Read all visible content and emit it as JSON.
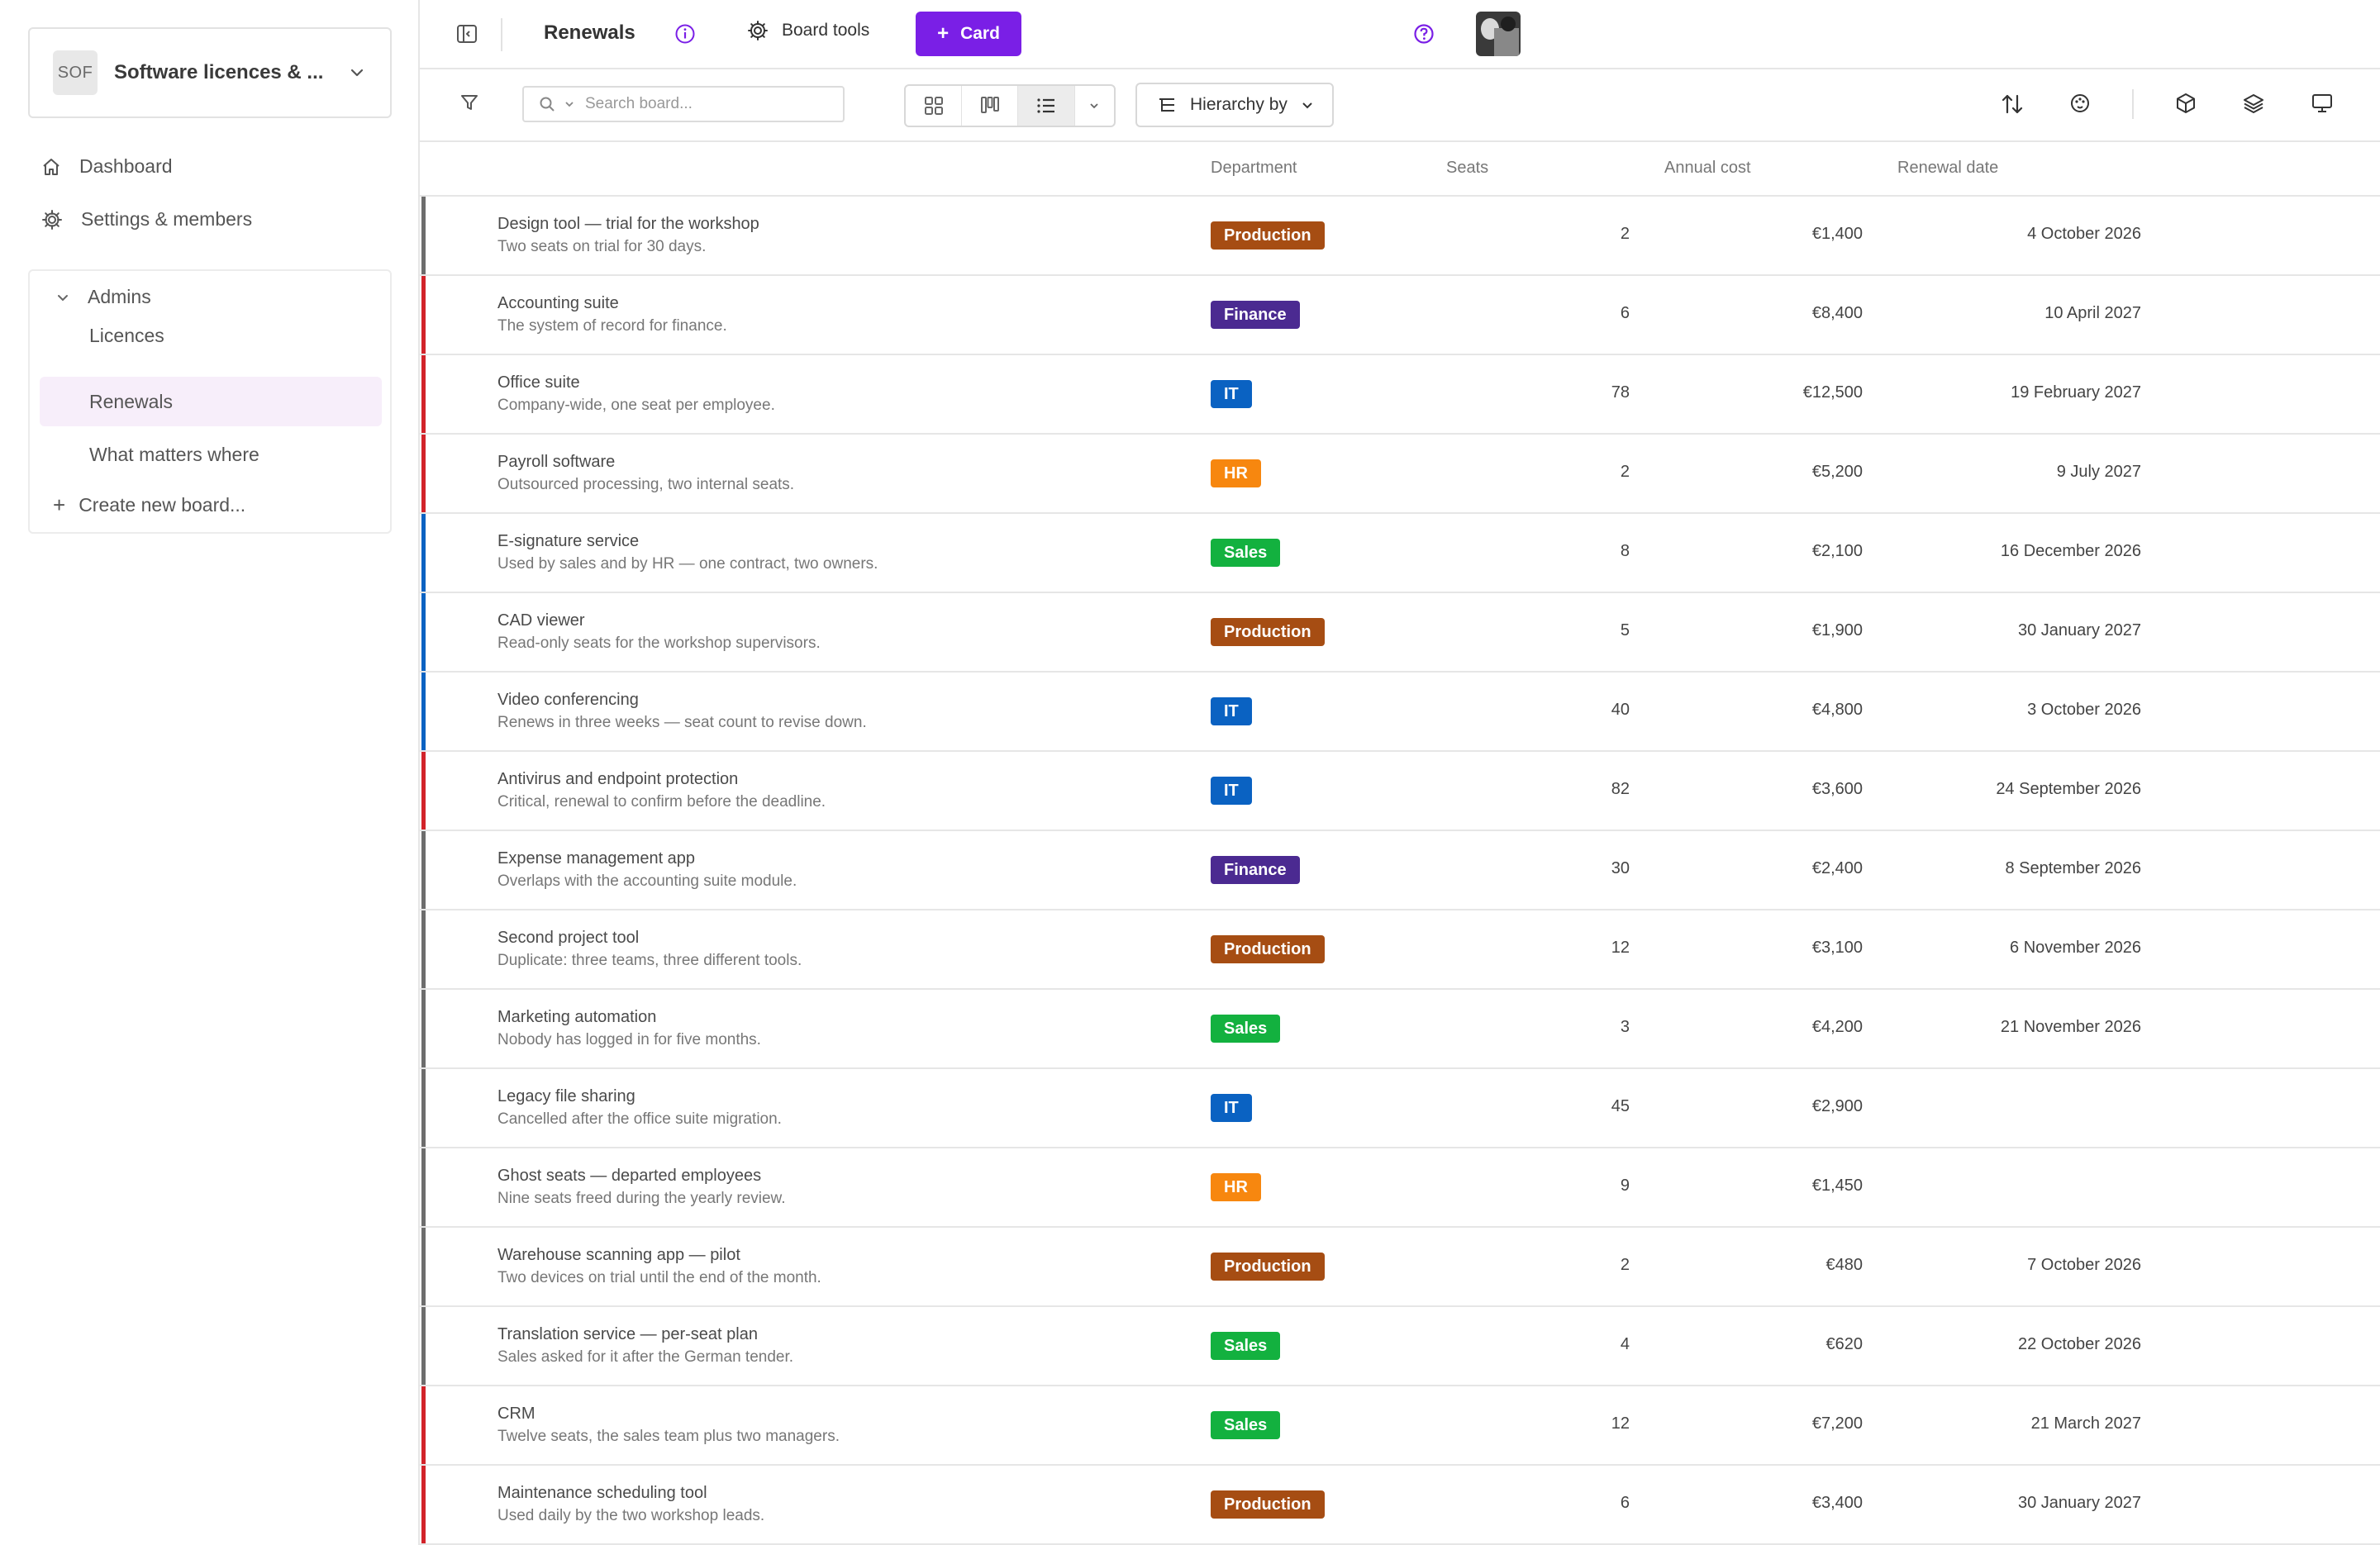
{
  "workspace": {
    "badge": "SOF",
    "name": "Software licences & ..."
  },
  "nav": {
    "dashboard": "Dashboard",
    "settings": "Settings & members"
  },
  "group": {
    "title": "Admins",
    "boards": [
      "Licences",
      "Renewals",
      "What matters where"
    ],
    "active_index": 1,
    "create": "Create new board..."
  },
  "topbar": {
    "title": "Renewals",
    "board_tools": "Board tools",
    "card_button": "Card"
  },
  "toolbar": {
    "search_placeholder": "Search board...",
    "hierarchy": "Hierarchy by"
  },
  "columns": {
    "department": "Department",
    "seats": "Seats",
    "cost": "Annual cost",
    "date": "Renewal date"
  },
  "colors": {
    "accent": "#7a1fe6",
    "Production": "#a64d13",
    "Finance": "#4b2a91",
    "IT": "#0a62c2",
    "HR": "#f7870f",
    "Sales": "#13b13f",
    "bar_gray": "#6d6d6d",
    "bar_red": "#d2232a",
    "bar_blue": "#0a62c2"
  },
  "rows": [
    {
      "name": "Design tool — trial for the workshop",
      "desc": "Two seats on trial for 30 days.",
      "dept": "Production",
      "seats": "2",
      "cost": "€1,400",
      "date": "4 October 2026",
      "bar": "gray"
    },
    {
      "name": "Accounting suite",
      "desc": "The system of record for finance.",
      "dept": "Finance",
      "seats": "6",
      "cost": "€8,400",
      "date": "10 April 2027",
      "bar": "red"
    },
    {
      "name": "Office suite",
      "desc": "Company-wide, one seat per employee.",
      "dept": "IT",
      "seats": "78",
      "cost": "€12,500",
      "date": "19 February 2027",
      "bar": "red"
    },
    {
      "name": "Payroll software",
      "desc": "Outsourced processing, two internal seats.",
      "dept": "HR",
      "seats": "2",
      "cost": "€5,200",
      "date": "9 July 2027",
      "bar": "red"
    },
    {
      "name": "E-signature service",
      "desc": "Used by sales and by HR — one contract, two owners.",
      "dept": "Sales",
      "seats": "8",
      "cost": "€2,100",
      "date": "16 December 2026",
      "bar": "blue"
    },
    {
      "name": "CAD viewer",
      "desc": "Read-only seats for the workshop supervisors.",
      "dept": "Production",
      "seats": "5",
      "cost": "€1,900",
      "date": "30 January 2027",
      "bar": "blue"
    },
    {
      "name": "Video conferencing",
      "desc": "Renews in three weeks — seat count to revise down.",
      "dept": "IT",
      "seats": "40",
      "cost": "€4,800",
      "date": "3 October 2026",
      "bar": "blue"
    },
    {
      "name": "Antivirus and endpoint protection",
      "desc": "Critical, renewal to confirm before the deadline.",
      "dept": "IT",
      "seats": "82",
      "cost": "€3,600",
      "date": "24 September 2026",
      "bar": "red"
    },
    {
      "name": "Expense management app",
      "desc": "Overlaps with the accounting suite module.",
      "dept": "Finance",
      "seats": "30",
      "cost": "€2,400",
      "date": "8 September 2026",
      "bar": "gray"
    },
    {
      "name": "Second project tool",
      "desc": "Duplicate: three teams, three different tools.",
      "dept": "Production",
      "seats": "12",
      "cost": "€3,100",
      "date": "6 November 2026",
      "bar": "gray"
    },
    {
      "name": "Marketing automation",
      "desc": "Nobody has logged in for five months.",
      "dept": "Sales",
      "seats": "3",
      "cost": "€4,200",
      "date": "21 November 2026",
      "bar": "gray"
    },
    {
      "name": "Legacy file sharing",
      "desc": "Cancelled after the office suite migration.",
      "dept": "IT",
      "seats": "45",
      "cost": "€2,900",
      "date": "",
      "bar": "gray"
    },
    {
      "name": "Ghost seats — departed employees",
      "desc": "Nine seats freed during the yearly review.",
      "dept": "HR",
      "seats": "9",
      "cost": "€1,450",
      "date": "",
      "bar": "gray"
    },
    {
      "name": "Warehouse scanning app — pilot",
      "desc": "Two devices on trial until the end of the month.",
      "dept": "Production",
      "seats": "2",
      "cost": "€480",
      "date": "7 October 2026",
      "bar": "gray"
    },
    {
      "name": "Translation service — per-seat plan",
      "desc": "Sales asked for it after the German tender.",
      "dept": "Sales",
      "seats": "4",
      "cost": "€620",
      "date": "22 October 2026",
      "bar": "gray"
    },
    {
      "name": "CRM",
      "desc": "Twelve seats, the sales team plus two managers.",
      "dept": "Sales",
      "seats": "12",
      "cost": "€7,200",
      "date": "21 March 2027",
      "bar": "red"
    },
    {
      "name": "Maintenance scheduling tool",
      "desc": "Used daily by the two workshop leads.",
      "dept": "Production",
      "seats": "6",
      "cost": "€3,400",
      "date": "30 January 2027",
      "bar": "red"
    }
  ]
}
